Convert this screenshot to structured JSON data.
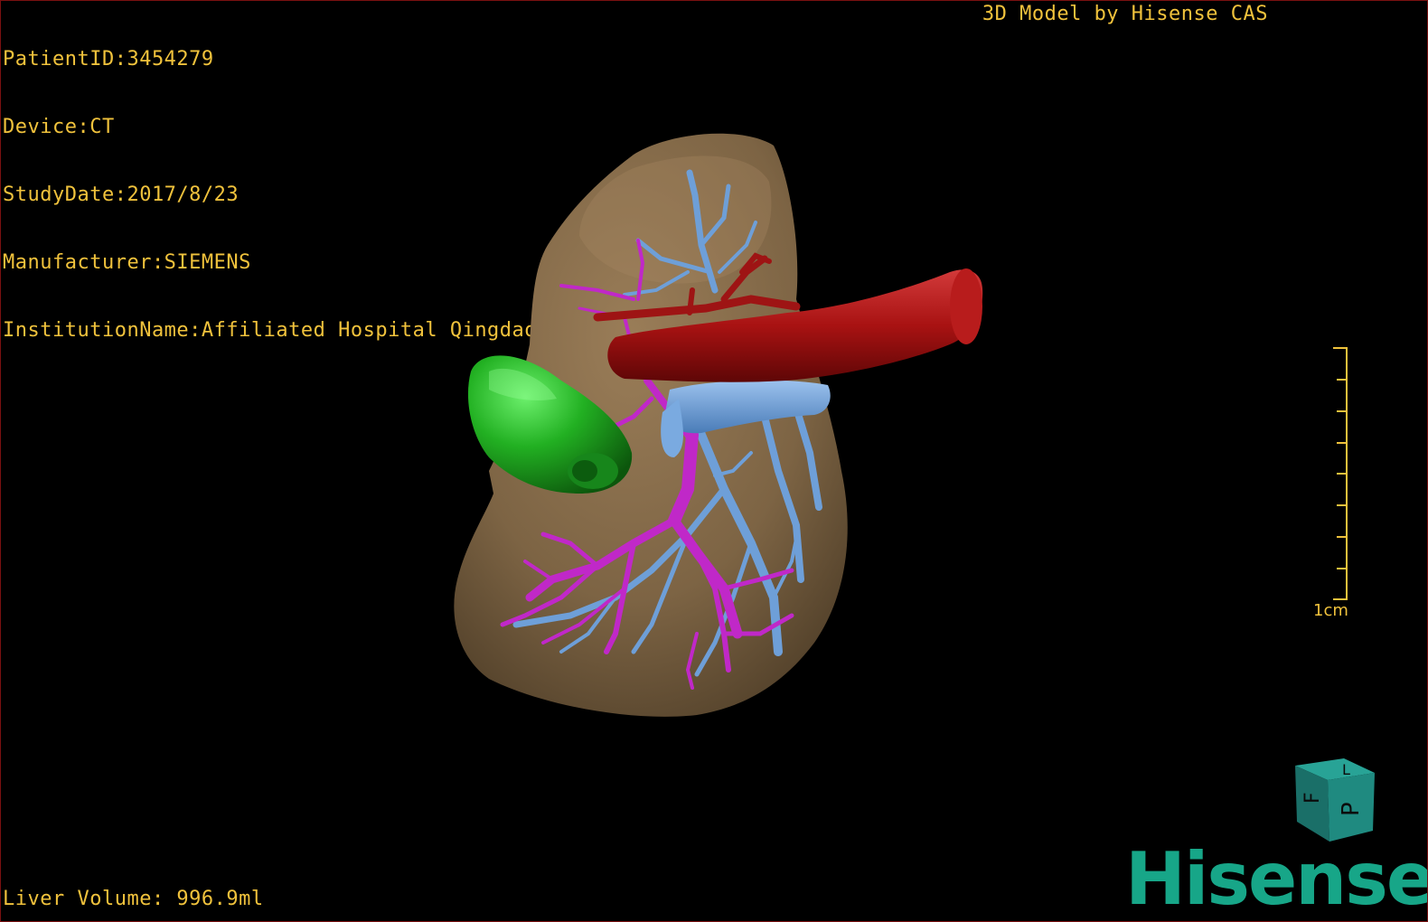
{
  "overlay": {
    "patient_line": "PatientID:3454279",
    "device_line": "Device:CT",
    "study_line": "StudyDate:2017/8/23",
    "manufacturer_line": "Manufacturer:SIEMENS",
    "institution_line": "InstitutionName:Affiliated Hospital Qingdao University-C",
    "credit": "3D Model by Hisense CAS",
    "volume": "Liver Volume: 996.9ml"
  },
  "scale_bar": {
    "label": "1cm",
    "ticks": 9
  },
  "orientation_cube": {
    "faces": [
      "F",
      "L",
      "P"
    ],
    "color": "#1f8a80"
  },
  "brand": {
    "name": "Hisense",
    "color": "#17a688"
  },
  "colors": {
    "liver": "#7d6444",
    "portal_vein": "#c028c8",
    "hepatic_vein": "#6e9fd8",
    "vena_cava": "#a81212",
    "gallbladder": "#1c9c1c",
    "overlay_text": "#f0c23c"
  }
}
